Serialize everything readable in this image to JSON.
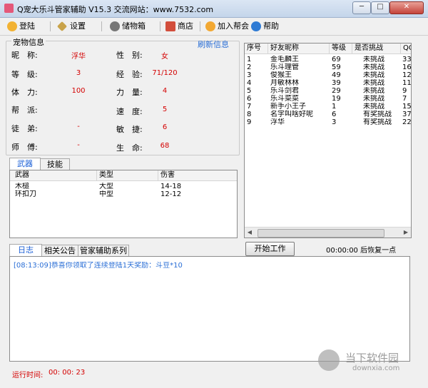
{
  "window": {
    "title": "Q宠大乐斗管家辅助 V15.3 交流网站：www.7532.com",
    "min": "─",
    "max": "□",
    "close": "✕"
  },
  "toolbar": {
    "login": "登陆",
    "settings": "设置",
    "storage": "储物箱",
    "shop": "商店",
    "join_guild": "加入帮会",
    "help": "帮助"
  },
  "pet": {
    "group_label": "宠物信息",
    "refresh": "刷新信息",
    "fields": [
      {
        "label": "昵　称:",
        "value": "浮华"
      },
      {
        "label": "性　别:",
        "value": "女"
      },
      {
        "label": "等　级:",
        "value": "3"
      },
      {
        "label": "经　验:",
        "value": "71/120"
      },
      {
        "label": "体　力:",
        "value": "100"
      },
      {
        "label": "力　量:",
        "value": "4"
      },
      {
        "label": "帮　派:",
        "value": ""
      },
      {
        "label": "速　度:",
        "value": "5"
      },
      {
        "label": "徒　弟:",
        "value": "-"
      },
      {
        "label": "敏　捷:",
        "value": "6"
      },
      {
        "label": "师　傅:",
        "value": "-"
      },
      {
        "label": "生　命:",
        "value": "68"
      }
    ]
  },
  "equip_tabs": [
    "武器",
    "技能"
  ],
  "weapons": {
    "headers": [
      "武器",
      "类型",
      "伤害"
    ],
    "rows": [
      [
        "木槌",
        "大型",
        "14-18"
      ],
      [
        "环扣刀",
        "中型",
        "12-12"
      ]
    ]
  },
  "friends": {
    "headers": [
      "序号",
      "好友昵称",
      "等级",
      "是否挑战",
      "QQ"
    ],
    "rows": [
      [
        "1",
        "金毛麟王",
        "69",
        "未挑战",
        "33"
      ],
      [
        "2",
        "乐斗理管",
        "59",
        "未挑战",
        "16"
      ],
      [
        "3",
        "俊猴王",
        "49",
        "未挑战",
        "12"
      ],
      [
        "4",
        "月敏林林",
        "39",
        "未挑战",
        "11"
      ],
      [
        "5",
        "乐斗剑君",
        "29",
        "未挑战",
        "9"
      ],
      [
        "6",
        "乐斗菜菜",
        "19",
        "未挑战",
        "7"
      ],
      [
        "7",
        "新手小王子",
        "1",
        "未挑战",
        "15"
      ],
      [
        "8",
        "名字叫啥好呢",
        "6",
        "有奖挑战",
        "37"
      ],
      [
        "9",
        "浮华",
        "3",
        "有奖挑战",
        "22"
      ]
    ]
  },
  "log_tabs": [
    "日志",
    "相关公告",
    "管家辅助系列"
  ],
  "start_button": "开始工作",
  "recover": "00:00:00 后恢复一点",
  "log": {
    "line": "[08:13:09]恭喜你领取了连续登陆1天奖励：斗豆*10"
  },
  "footer": {
    "runtime_label": "运行时间:",
    "runtime": "00: 00: 23"
  },
  "watermark": {
    "name": "当下软件园",
    "url": "downxia.com"
  },
  "colors": {
    "value_red": "#d40000",
    "link_blue": "#2b6fd6"
  }
}
